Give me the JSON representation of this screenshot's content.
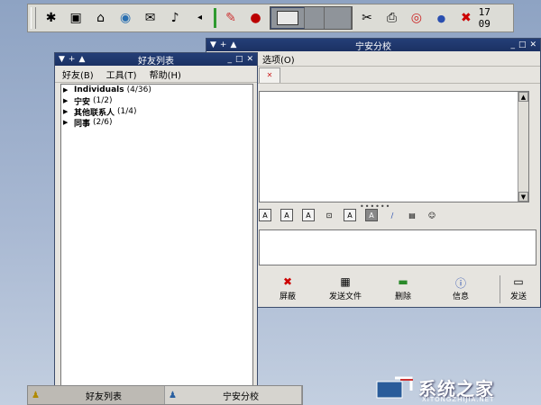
{
  "panel": {
    "clock": "17 09",
    "icons": [
      "launcher-icon",
      "terminal-icon",
      "file-manager-icon",
      "browser-icon",
      "mail-icon",
      "speaker-icon",
      "mute-icon",
      "text-editor-icon",
      "games-icon",
      "config-icon",
      "printer-icon",
      "help-icon",
      "info-icon",
      "logout-icon"
    ],
    "pager_desktops": 4
  },
  "buddy_window": {
    "title": "好友列表",
    "menu": [
      "好友(B)",
      "工具(T)",
      "帮助(H)"
    ],
    "groups": [
      {
        "name": "Individuals",
        "count": "(4/36)"
      },
      {
        "name": "宁安",
        "count": "(1/2)"
      },
      {
        "name": "其他联系人",
        "count": "(1/4)"
      },
      {
        "name": "同事",
        "count": "(2/6)"
      }
    ]
  },
  "chat_window": {
    "title": "宁安分校",
    "menu": [
      "选项(O)"
    ],
    "actions": [
      "屏蔽",
      "发送文件",
      "删除",
      "信息",
      "发送"
    ],
    "format_icons": [
      "bold-icon",
      "text-size-up-icon",
      "text-size-down-icon",
      "image-icon",
      "font-icon",
      "background-icon",
      "link-icon",
      "insert-icon",
      "smiley-icon"
    ]
  },
  "taskbar": {
    "items": [
      {
        "label": "好友列表",
        "active": true
      },
      {
        "label": "宁安分校",
        "active": false
      }
    ]
  },
  "watermark": {
    "text": "系统之家",
    "url": "XITONGZHIJIA.NET"
  },
  "colors": {
    "titlebar": "#1b3163",
    "desktop": "#a8b8d2",
    "accent_green": "#2f9a2f"
  }
}
